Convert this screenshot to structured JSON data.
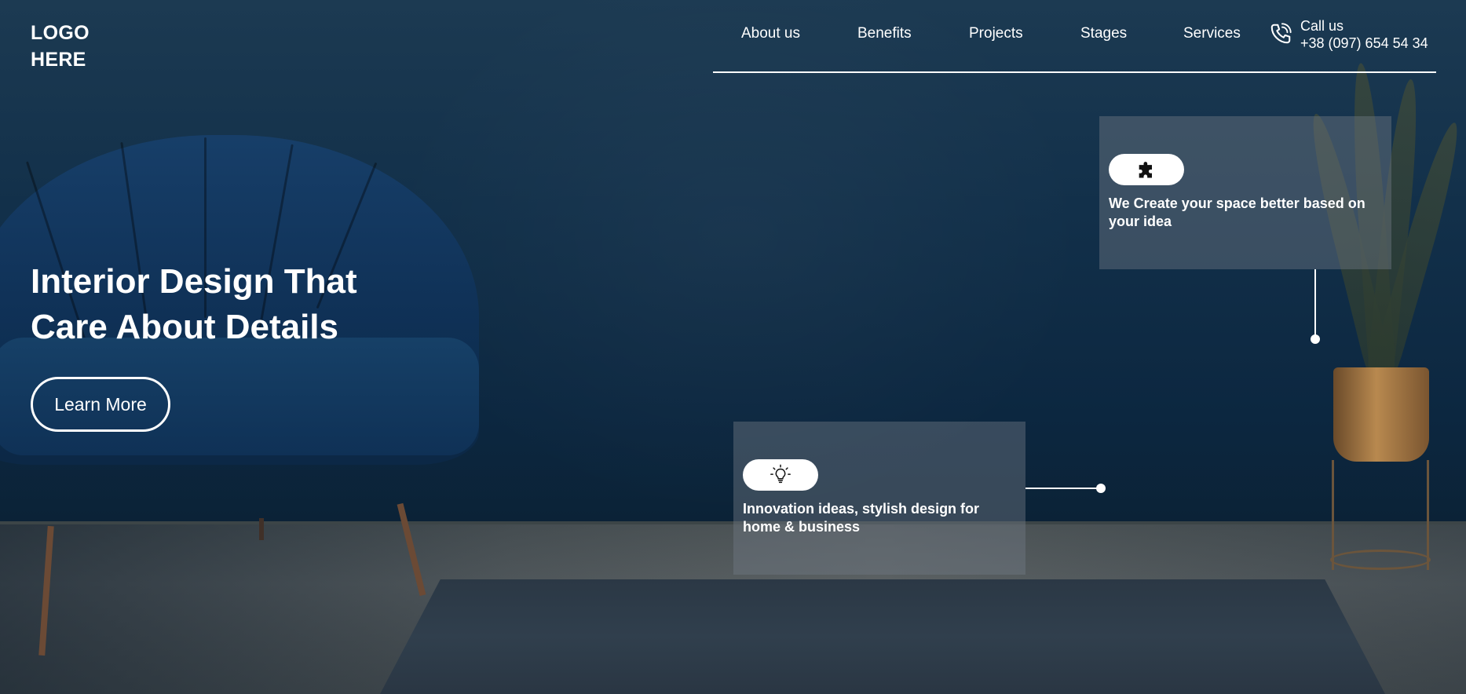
{
  "logo": {
    "line1": "LOGO",
    "line2": "HERE"
  },
  "nav": {
    "items": [
      {
        "label": "About us"
      },
      {
        "label": "Benefits"
      },
      {
        "label": "Projects"
      },
      {
        "label": "Stages"
      },
      {
        "label": "Services"
      }
    ]
  },
  "contact": {
    "label": "Call us",
    "phone": "+38 (097) 654 54 34",
    "icon": "phone-icon"
  },
  "hero": {
    "headline_line1": "Interior Design That",
    "headline_line2": "Care About Details",
    "cta_label": "Learn More"
  },
  "features": [
    {
      "icon": "puzzle-icon",
      "text_line1": "We Create your space better based on",
      "text_line2": "your idea"
    },
    {
      "icon": "lightbulb-icon",
      "text_line1": "Innovation ideas, stylish design for",
      "text_line2": "home & business"
    }
  ],
  "colors": {
    "text": "#ffffff",
    "wall": "#0c2740",
    "card_overlay": "rgba(110,120,130,0.45)",
    "pill": "#ffffff"
  }
}
